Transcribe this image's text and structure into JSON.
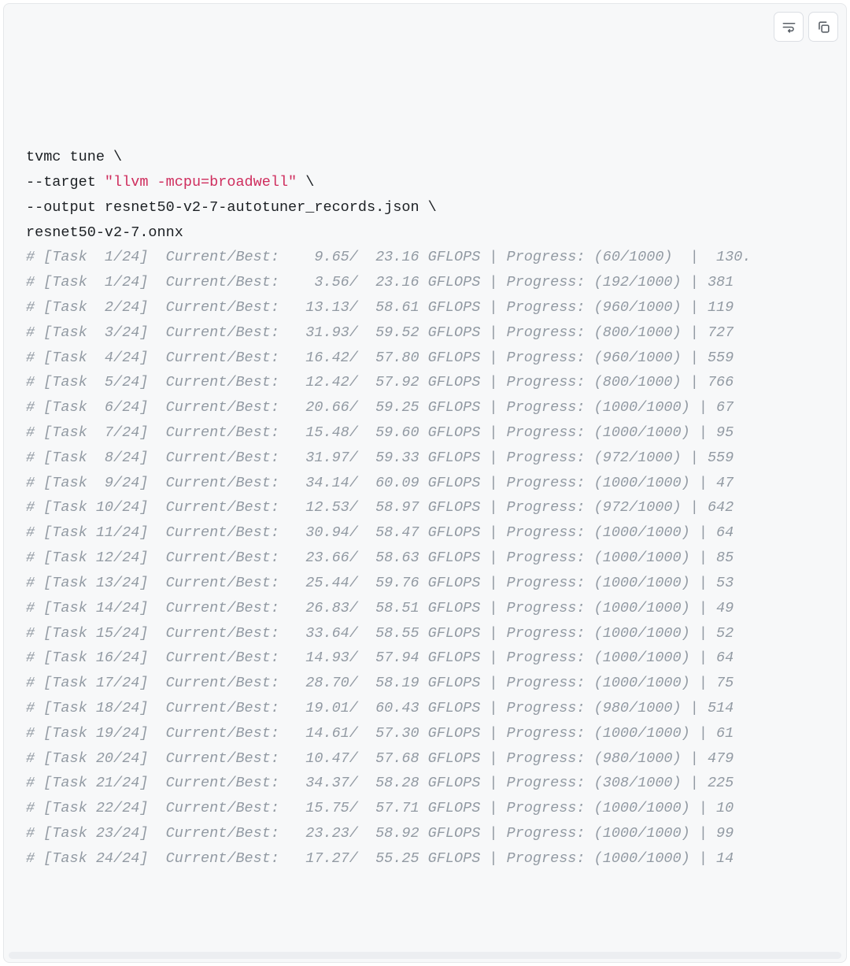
{
  "command": {
    "line1_pre": "tvmc tune \\",
    "line2_pre": "--target ",
    "line2_str": "\"llvm -mcpu=broadwell\"",
    "line2_post": " \\",
    "line3": "--output resnet50-v2-7-autotuner_records.json \\",
    "line4": "resnet50-v2-7.onnx"
  },
  "rows": [
    {
      "task": " 1",
      "total": "24",
      "cur": "  9.65",
      "best": " 23.16",
      "progress": "(60/1000) ",
      "tail": " |  130."
    },
    {
      "task": " 1",
      "total": "24",
      "cur": "  3.56",
      "best": " 23.16",
      "progress": "(192/1000) ",
      "tail": "| 381"
    },
    {
      "task": " 2",
      "total": "24",
      "cur": " 13.13",
      "best": " 58.61",
      "progress": "(960/1000) ",
      "tail": "| 119"
    },
    {
      "task": " 3",
      "total": "24",
      "cur": " 31.93",
      "best": " 59.52",
      "progress": "(800/1000) ",
      "tail": "| 727"
    },
    {
      "task": " 4",
      "total": "24",
      "cur": " 16.42",
      "best": " 57.80",
      "progress": "(960/1000) ",
      "tail": "| 559"
    },
    {
      "task": " 5",
      "total": "24",
      "cur": " 12.42",
      "best": " 57.92",
      "progress": "(800/1000) ",
      "tail": "| 766"
    },
    {
      "task": " 6",
      "total": "24",
      "cur": " 20.66",
      "best": " 59.25",
      "progress": "(1000/1000)",
      "tail": " | 67"
    },
    {
      "task": " 7",
      "total": "24",
      "cur": " 15.48",
      "best": " 59.60",
      "progress": "(1000/1000)",
      "tail": " | 95"
    },
    {
      "task": " 8",
      "total": "24",
      "cur": " 31.97",
      "best": " 59.33",
      "progress": "(972/1000) ",
      "tail": "| 559"
    },
    {
      "task": " 9",
      "total": "24",
      "cur": " 34.14",
      "best": " 60.09",
      "progress": "(1000/1000)",
      "tail": " | 47"
    },
    {
      "task": "10",
      "total": "24",
      "cur": " 12.53",
      "best": " 58.97",
      "progress": "(972/1000) ",
      "tail": "| 642"
    },
    {
      "task": "11",
      "total": "24",
      "cur": " 30.94",
      "best": " 58.47",
      "progress": "(1000/1000)",
      "tail": " | 64"
    },
    {
      "task": "12",
      "total": "24",
      "cur": " 23.66",
      "best": " 58.63",
      "progress": "(1000/1000)",
      "tail": " | 85"
    },
    {
      "task": "13",
      "total": "24",
      "cur": " 25.44",
      "best": " 59.76",
      "progress": "(1000/1000)",
      "tail": " | 53"
    },
    {
      "task": "14",
      "total": "24",
      "cur": " 26.83",
      "best": " 58.51",
      "progress": "(1000/1000)",
      "tail": " | 49"
    },
    {
      "task": "15",
      "total": "24",
      "cur": " 33.64",
      "best": " 58.55",
      "progress": "(1000/1000)",
      "tail": " | 52"
    },
    {
      "task": "16",
      "total": "24",
      "cur": " 14.93",
      "best": " 57.94",
      "progress": "(1000/1000)",
      "tail": " | 64"
    },
    {
      "task": "17",
      "total": "24",
      "cur": " 28.70",
      "best": " 58.19",
      "progress": "(1000/1000)",
      "tail": " | 75"
    },
    {
      "task": "18",
      "total": "24",
      "cur": " 19.01",
      "best": " 60.43",
      "progress": "(980/1000) ",
      "tail": "| 514"
    },
    {
      "task": "19",
      "total": "24",
      "cur": " 14.61",
      "best": " 57.30",
      "progress": "(1000/1000)",
      "tail": " | 61"
    },
    {
      "task": "20",
      "total": "24",
      "cur": " 10.47",
      "best": " 57.68",
      "progress": "(980/1000) ",
      "tail": "| 479"
    },
    {
      "task": "21",
      "total": "24",
      "cur": " 34.37",
      "best": " 58.28",
      "progress": "(308/1000) ",
      "tail": "| 225"
    },
    {
      "task": "22",
      "total": "24",
      "cur": " 15.75",
      "best": " 57.71",
      "progress": "(1000/1000)",
      "tail": " | 10"
    },
    {
      "task": "23",
      "total": "24",
      "cur": " 23.23",
      "best": " 58.92",
      "progress": "(1000/1000)",
      "tail": " | 99"
    },
    {
      "task": "24",
      "total": "24",
      "cur": " 17.27",
      "best": " 55.25",
      "progress": "(1000/1000)",
      "tail": " | 14"
    }
  ]
}
